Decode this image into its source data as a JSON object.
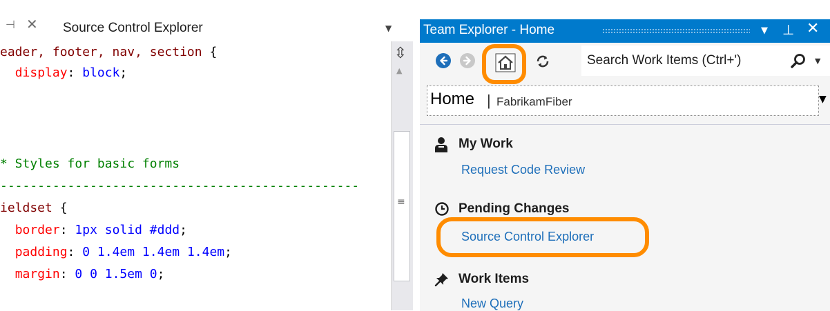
{
  "editor": {
    "tab": {
      "title": "Source Control Explorer",
      "pin_glyph": "⊣",
      "close_glyph": "✕",
      "dropdown_glyph": "▼"
    },
    "lines": [
      {
        "parts": [
          {
            "cls": "sel",
            "text": "eader, footer, nav, section "
          },
          {
            "cls": "punc",
            "text": "{"
          }
        ]
      },
      {
        "parts": [
          {
            "cls": "punc",
            "text": "  "
          },
          {
            "cls": "prop",
            "text": "display"
          },
          {
            "cls": "punc",
            "text": ": "
          },
          {
            "cls": "val",
            "text": "block"
          },
          {
            "cls": "punc",
            "text": ";"
          }
        ]
      },
      {
        "parts": []
      },
      {
        "parts": []
      },
      {
        "parts": [
          {
            "cls": "cmt",
            "text": "* Styles for basic forms"
          }
        ]
      },
      {
        "parts": [
          {
            "cls": "cmt",
            "text": "------------------------------------------------"
          }
        ]
      },
      {
        "parts": [
          {
            "cls": "sel",
            "text": "ieldset "
          },
          {
            "cls": "punc",
            "text": "{"
          }
        ]
      },
      {
        "parts": [
          {
            "cls": "punc",
            "text": "  "
          },
          {
            "cls": "prop",
            "text": "border"
          },
          {
            "cls": "punc",
            "text": ": "
          },
          {
            "cls": "val",
            "text": "1px solid #ddd"
          },
          {
            "cls": "punc",
            "text": ";"
          }
        ]
      },
      {
        "parts": [
          {
            "cls": "punc",
            "text": "  "
          },
          {
            "cls": "prop",
            "text": "padding"
          },
          {
            "cls": "punc",
            "text": ": "
          },
          {
            "cls": "val",
            "text": "0 1.4em 1.4em 1.4em"
          },
          {
            "cls": "punc",
            "text": ";"
          }
        ]
      },
      {
        "parts": [
          {
            "cls": "punc",
            "text": "  "
          },
          {
            "cls": "prop",
            "text": "margin"
          },
          {
            "cls": "punc",
            "text": ": "
          },
          {
            "cls": "val",
            "text": "0 0 1.5em 0"
          },
          {
            "cls": "punc",
            "text": ";"
          }
        ]
      }
    ],
    "scrollbar": {
      "splitter_glyph": "⇳",
      "up_glyph": "▲",
      "grip_glyph": "≡"
    }
  },
  "team_explorer": {
    "title": "Team Explorer - Home",
    "title_buttons": {
      "dropdown": "▼",
      "pin": "⊥",
      "close": "✕"
    },
    "toolbar": {
      "back_icon": "back-arrow",
      "forward_icon": "forward-arrow",
      "home_icon": "home",
      "refresh_icon": "refresh",
      "search_placeholder": "Search Work Items (Ctrl+')",
      "search_dropdown": "▼"
    },
    "home_selector": {
      "label": "Home",
      "separator": "|",
      "project": "FabrikamFiber",
      "dropdown": "▼"
    },
    "sections": [
      {
        "title": "My Work",
        "icon": "person",
        "links": [
          "Request Code Review"
        ]
      },
      {
        "title": "Pending Changes",
        "icon": "clock",
        "links": [
          "Source Control Explorer"
        ]
      },
      {
        "title": "Work Items",
        "icon": "pin",
        "links": [
          "New Query"
        ]
      }
    ],
    "highlight_color": "#ff8c00",
    "accent_color": "#007acc",
    "link_color": "#1e6fba"
  }
}
